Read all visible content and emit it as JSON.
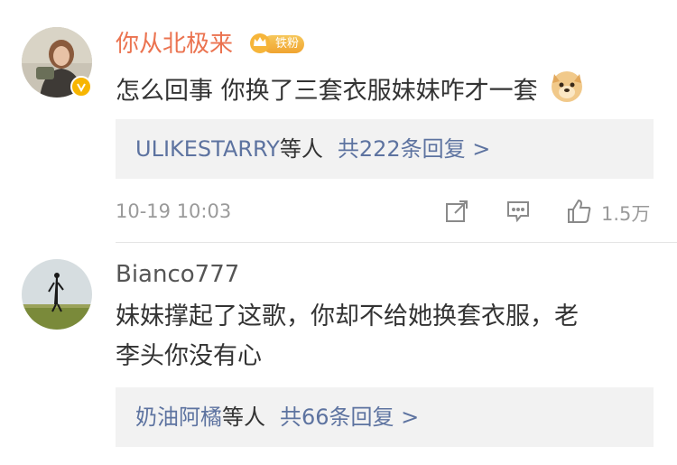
{
  "comments": [
    {
      "username": "你从北极来",
      "badge": "铁粉",
      "text": "怎么回事 你换了三套衣服妹妹咋才一套",
      "reply_user": "ULIKESTARRY",
      "reply_suffix": "等人",
      "reply_count": "共222条回复 >",
      "timestamp": "10-19 10:03",
      "likes": "1.5万",
      "username_color": "#eb7350"
    },
    {
      "username": "Bianco777",
      "text_line1": "妹妹撑起了这歌，你却不给她换套衣服，老",
      "text_line2": "李头你没有心",
      "reply_user": "奶油阿橘",
      "reply_suffix": "等人",
      "reply_count": "共66条回复 >",
      "username_color": "#555555"
    }
  ],
  "colors": {
    "link": "#5d73a0",
    "meta": "#9a9a9a",
    "reply_bg": "#f2f2f2",
    "verified": "#f7b500"
  }
}
